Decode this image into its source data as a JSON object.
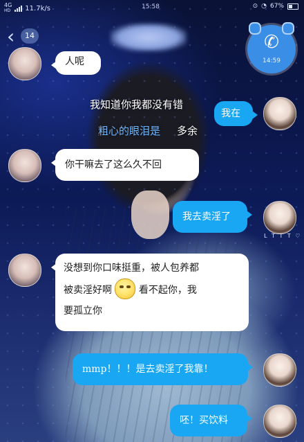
{
  "status_bar": {
    "network": "4G",
    "network_sub": "HD",
    "speed": "11.7k/s",
    "time": "15:58",
    "battery": "67%"
  },
  "header": {
    "back_icon": "chevron-left-icon",
    "unread_count": "14",
    "call_icon": "phone-icon",
    "call_time": "14:59"
  },
  "messages": {
    "m1_partial": "人呢",
    "overlay_line1": "我知道你我都没有错",
    "overlay_line2_blue": "粗心的眼泪是",
    "overlay_line2_white": "多余",
    "m2_right": "我在",
    "m3_left": "你干嘛去了这么久不回",
    "m4_right": "我去卖淫了",
    "m4_handle": "L T T T ♡",
    "m5_left_line1": "没想到你口味挺重，被人包养都",
    "m5_left_line2a": "被卖淫好啊",
    "m5_left_line2b": "看不起你，我",
    "m5_left_line3": "要孤立你",
    "m6_right": "mmp！！！是去卖淫了我靠！",
    "m7_right": "呸！买饮料"
  }
}
